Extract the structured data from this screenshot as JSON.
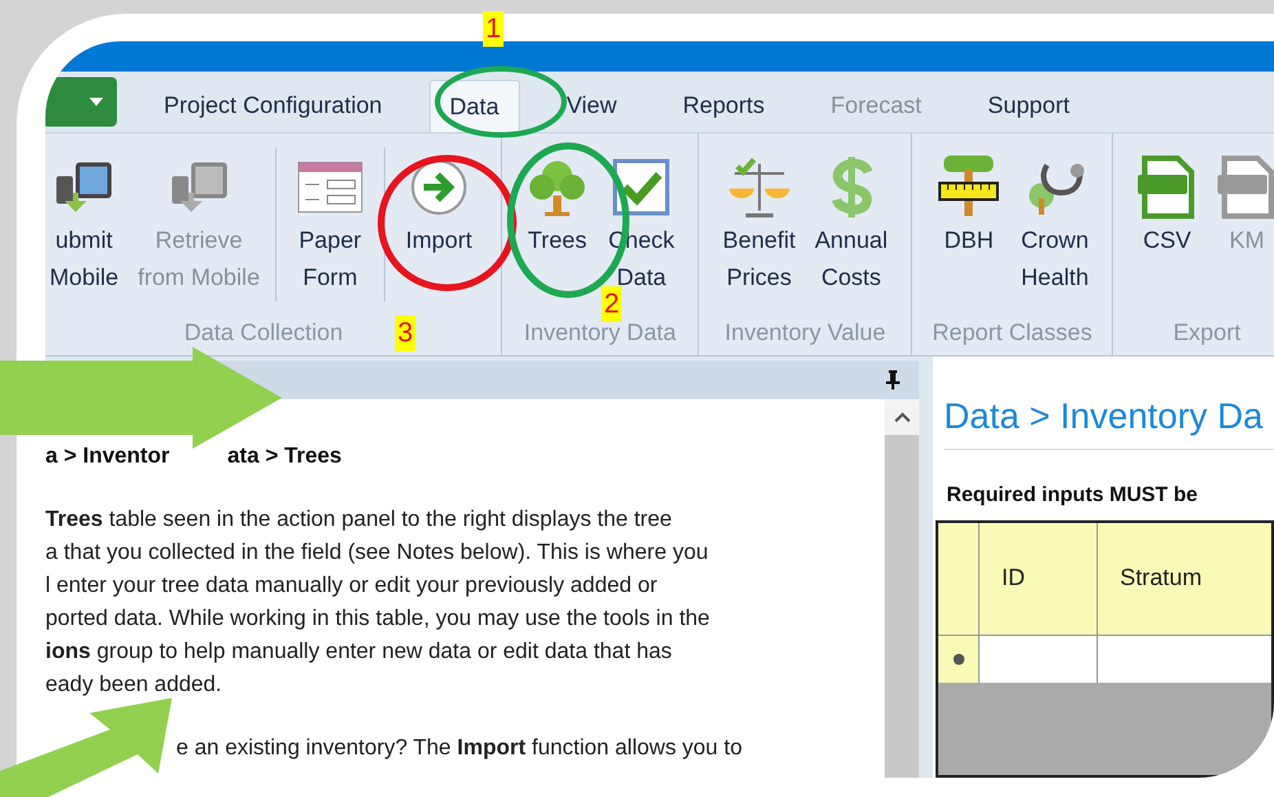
{
  "tabs": [
    {
      "label": "Project Configuration",
      "selected": false,
      "disabled": false
    },
    {
      "label": "Data",
      "selected": true,
      "disabled": false
    },
    {
      "label": "View",
      "selected": false,
      "disabled": false
    },
    {
      "label": "Reports",
      "selected": false,
      "disabled": false
    },
    {
      "label": "Forecast",
      "selected": false,
      "disabled": true
    },
    {
      "label": "Support",
      "selected": false,
      "disabled": false
    }
  ],
  "ribbon_groups": [
    {
      "label": "Data Collection",
      "sets": [
        [
          {
            "lines": [
              "ubmit",
              "Mobile"
            ],
            "disabled": false
          },
          {
            "lines": [
              "Retrieve",
              "from Mobile"
            ],
            "disabled": true
          }
        ],
        [
          {
            "lines": [
              "Paper",
              "Form"
            ],
            "disabled": false
          }
        ],
        [
          {
            "lines": [
              "Import"
            ],
            "disabled": false
          }
        ]
      ]
    },
    {
      "label": "Inventory Data",
      "sets": [
        [
          {
            "lines": [
              "Trees"
            ],
            "disabled": false
          },
          {
            "lines": [
              "Check",
              "Data"
            ],
            "disabled": false
          }
        ]
      ]
    },
    {
      "label": "Inventory Value",
      "sets": [
        [
          {
            "lines": [
              "Benefit",
              "Prices"
            ],
            "disabled": false
          },
          {
            "lines": [
              "Annual",
              "Costs"
            ],
            "disabled": false
          }
        ]
      ]
    },
    {
      "label": "Report Classes",
      "sets": [
        [
          {
            "lines": [
              "DBH"
            ],
            "disabled": false
          },
          {
            "lines": [
              "Crown",
              "Health"
            ],
            "disabled": false
          }
        ]
      ]
    },
    {
      "label": "Export",
      "sets": [
        [
          {
            "lines": [
              "CSV"
            ],
            "disabled": false
          },
          {
            "lines": [
              "KM"
            ],
            "disabled": true
          }
        ]
      ]
    }
  ],
  "help_panel": {
    "heading_parts": [
      "a > Inventor",
      "ata > Trees"
    ],
    "paragraphs": [
      [
        "**Trees** table seen in the action panel to the right displays the tree",
        "a that you collected in the field (see Notes below). This is where you",
        "l enter your tree data manually or edit your previously added or",
        "ported data. While working in this table, you may use the tools in the",
        "**ions** group to help manually enter new data or edit data that has",
        "eady been added."
      ],
      [
        "e an existing inventory? The **Import** function allows you to"
      ]
    ]
  },
  "action_panel": {
    "title": "Data > Inventory Da",
    "notice": "Required inputs MUST be",
    "table": {
      "columns": [
        "ID",
        "Stratum"
      ]
    }
  },
  "annotations": [
    {
      "label": "1"
    },
    {
      "label": "2"
    },
    {
      "label": "3"
    }
  ]
}
